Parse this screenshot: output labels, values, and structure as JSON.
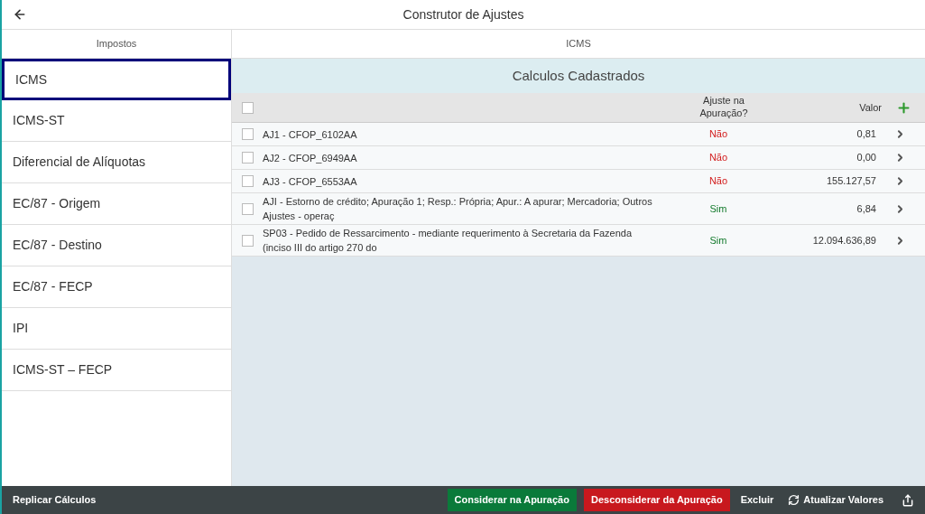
{
  "header": {
    "title": "Construtor de Ajustes"
  },
  "sidebar": {
    "heading": "Impostos",
    "items": [
      {
        "label": "ICMS",
        "selected": true
      },
      {
        "label": "ICMS-ST",
        "selected": false
      },
      {
        "label": "Diferencial de Alíquotas",
        "selected": false
      },
      {
        "label": "EC/87 - Origem",
        "selected": false
      },
      {
        "label": "EC/87 - Destino",
        "selected": false
      },
      {
        "label": "EC/87 - FECP",
        "selected": false
      },
      {
        "label": "IPI",
        "selected": false
      },
      {
        "label": "ICMS-ST – FECP",
        "selected": false
      }
    ]
  },
  "main": {
    "heading": "ICMS",
    "section_title": "Calculos Cadastrados",
    "table": {
      "select_all_checked": false,
      "columns": [
        "Ajuste na Apuração?",
        "Valor"
      ],
      "rows": [
        {
          "checked": false,
          "name": "AJ1 - CFOP_6102AA",
          "adjust": "Não",
          "adjusted": false,
          "value": "0,81"
        },
        {
          "checked": false,
          "name": "AJ2 - CFOP_6949AA",
          "adjust": "Não",
          "adjusted": false,
          "value": "0,00"
        },
        {
          "checked": false,
          "name": "AJ3 - CFOP_6553AA",
          "adjust": "Não",
          "adjusted": false,
          "value": "155.127,57"
        },
        {
          "checked": false,
          "name": "AJI - Estorno de crédito; Apuração 1; Resp.: Própria; Apur.: A apurar; Mercadoria; Outros Ajustes - operaç",
          "adjust": "Sim",
          "adjusted": true,
          "value": "6,84"
        },
        {
          "checked": false,
          "name": "SP03 - Pedido de Ressarcimento - mediante requerimento à Secretaria da Fazenda (inciso III do artigo 270 do",
          "adjust": "Sim",
          "adjusted": true,
          "value": "12.094.636,89"
        }
      ]
    }
  },
  "footer": {
    "left": "Replicar Cálculos",
    "actions": [
      {
        "kind": "positive",
        "label": "Considerar na Apuração"
      },
      {
        "kind": "negative",
        "label": "Desconsiderar da Apuração"
      },
      {
        "kind": "plain",
        "label": "Excluir"
      },
      {
        "kind": "refresh",
        "label": "Atualizar Valores"
      }
    ]
  }
}
